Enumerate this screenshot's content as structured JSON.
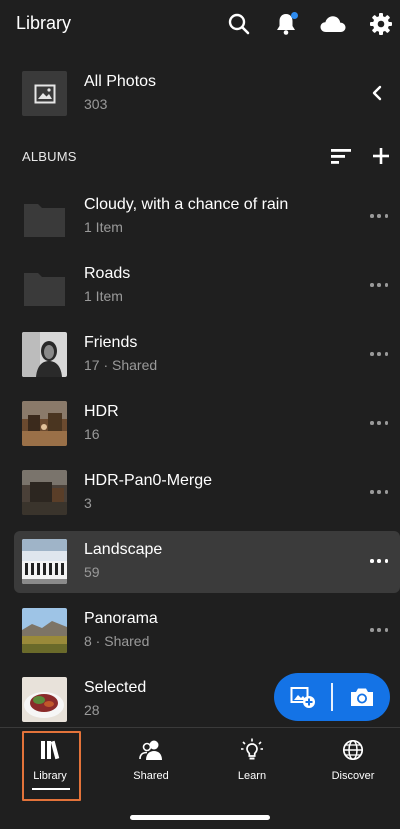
{
  "header": {
    "title": "Library",
    "icons": [
      "search-icon",
      "bell-icon",
      "cloud-icon",
      "gear-icon"
    ],
    "notification_dot_color": "#2e8cf0"
  },
  "all_photos": {
    "title": "All Photos",
    "count": "303"
  },
  "albums_section": {
    "label": "ALBUMS"
  },
  "albums": [
    {
      "title": "Cloudy, with a chance of rain",
      "subtitle": "1 Item",
      "type": "folder"
    },
    {
      "title": "Roads",
      "subtitle": "1 Item",
      "type": "folder"
    },
    {
      "title": "Friends",
      "subtitle": "17 · Shared",
      "type": "photo"
    },
    {
      "title": "HDR",
      "subtitle": "16",
      "type": "photo"
    },
    {
      "title": "HDR-Pan0-Merge",
      "subtitle": "3",
      "type": "photo"
    },
    {
      "title": "Landscape",
      "subtitle": "59",
      "type": "photo",
      "selected": true
    },
    {
      "title": "Panorama",
      "subtitle": "8 · Shared",
      "type": "photo"
    },
    {
      "title": "Selected",
      "subtitle": "28",
      "type": "photo"
    }
  ],
  "fab": {
    "color": "#1473e6",
    "actions": [
      "add-photo-icon",
      "camera-icon"
    ]
  },
  "bottom_nav": {
    "items": [
      {
        "label": "Library",
        "active": true
      },
      {
        "label": "Shared"
      },
      {
        "label": "Learn"
      },
      {
        "label": "Discover"
      }
    ],
    "highlight_color": "#e3733a"
  }
}
